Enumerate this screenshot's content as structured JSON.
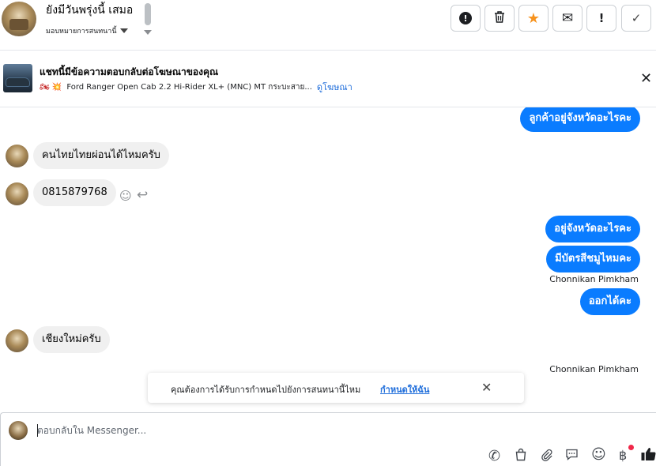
{
  "header": {
    "contact_name": "ยังมีวันพรุ่งนี้ เสมอ",
    "assign_label": "มอบหมายการสนทนานี้",
    "actions": {
      "report_icon": "!",
      "delete_icon": "🗑",
      "star_icon": "★",
      "mark_unread_icon": "✉",
      "spam_icon": "!",
      "done_icon": "✓"
    }
  },
  "ad": {
    "title": "แชทนี้มีข้อความตอบกลับต่อโฆษณาของคุณ",
    "tag_icons": "🏍 💥",
    "ad_text": "Ford Ranger Open Cab 2.2 Hi-Rider XL+ (MNC) MT กระบะสาย...",
    "view_ad_link": "ดูโฆษณา",
    "close_icon": "✕"
  },
  "messages": {
    "m1": "ลูกค้าอยู่จังหวัดอะไรคะ",
    "m2": "คนไทยไทยผ่อนได้ไหมครับ",
    "m3": "0815879768",
    "m4": "อยู่จังหวัดอะไรคะ",
    "m5": "มีบัตรสีชมูไหมคะ",
    "m5_sender": "Chonnikan Pimkham",
    "m6": "ออกได้คะ",
    "m7": "เชียงใหม่ครับ",
    "m7_sender": "Chonnikan Pimkham",
    "react_icon": "☺",
    "reply_icon": "↩"
  },
  "toast": {
    "text": "คุณต้องการได้รับการกำหนดไปยังการสนทนานี้ไหม",
    "link": "กำหนดให้ฉัน",
    "close_icon": "✕"
  },
  "composer": {
    "placeholder": "ตอบกลับใน Messenger...",
    "icons": {
      "call": "✆",
      "shop": "👜",
      "attach": "📎",
      "saved_replies": "💬",
      "emoji": "☺",
      "payment": "฿",
      "like": "👍"
    }
  }
}
